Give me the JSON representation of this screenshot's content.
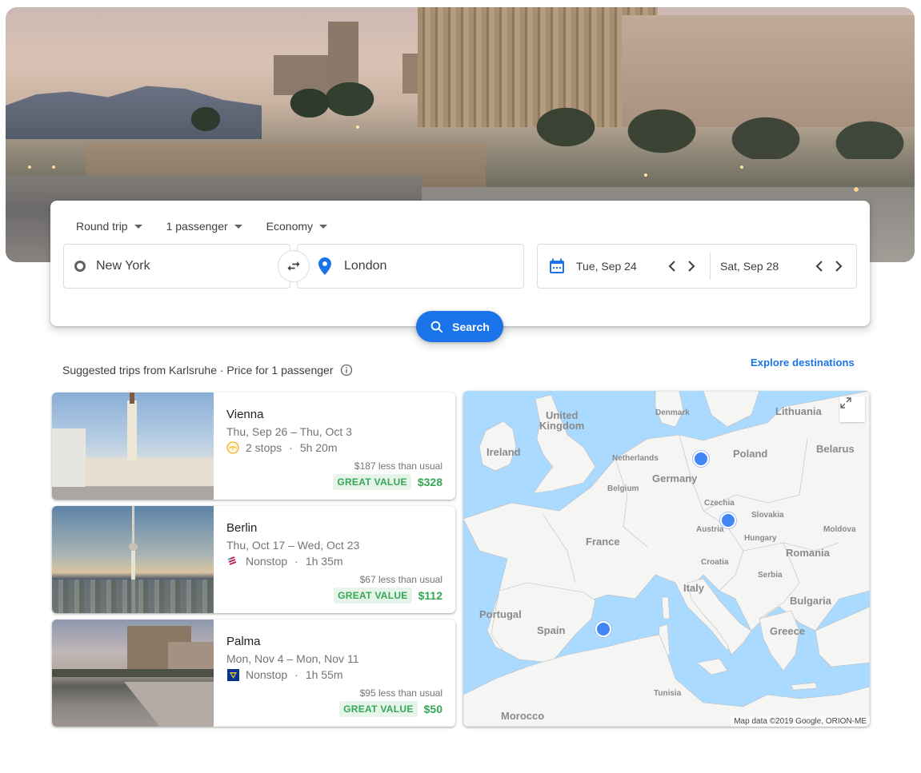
{
  "search": {
    "trip_type": "Round trip",
    "passengers": "1 passenger",
    "cabin_class": "Economy",
    "origin": "New York",
    "destination": "London",
    "depart_date": "Tue, Sep 24",
    "return_date": "Sat, Sep 28",
    "search_label": "Search"
  },
  "suggestions": {
    "title": "Suggested trips from Karlsruhe · Price for 1 passenger",
    "explore_label": "Explore destinations",
    "trips": [
      {
        "city": "Vienna",
        "dates": "Thu, Sep 26 – Thu, Oct 3",
        "stops": "2 stops",
        "duration": "5h 20m",
        "airline_icon": "lufthansa-icon",
        "savings": "$187 less than usual",
        "badge": "GREAT VALUE",
        "price": "$328"
      },
      {
        "city": "Berlin",
        "dates": "Thu, Oct 17 – Wed, Oct 23",
        "stops": "Nonstop",
        "duration": "1h 35m",
        "airline_icon": "eurowings-icon",
        "savings": "$67 less than usual",
        "badge": "GREAT VALUE",
        "price": "$112"
      },
      {
        "city": "Palma",
        "dates": "Mon, Nov 4 – Mon, Nov 11",
        "stops": "Nonstop",
        "duration": "1h 55m",
        "airline_icon": "ryanair-icon",
        "savings": "$95 less than usual",
        "badge": "GREAT VALUE",
        "price": "$50"
      }
    ]
  },
  "map": {
    "labels_large": [
      "United",
      "Kingdom",
      "Ireland",
      "Germany",
      "Poland",
      "Belarus",
      "Lithuania",
      "France",
      "Romania",
      "Italy",
      "Spain",
      "Portugal",
      "Bulgaria",
      "Greece",
      "Morocco"
    ],
    "labels_small": [
      "Denmark",
      "Netherlands",
      "Belgium",
      "Czechia",
      "Slovakia",
      "Austria",
      "Hungary",
      "Moldova",
      "Croatia",
      "Serbia",
      "Tunisia"
    ],
    "markers": [
      "Berlin",
      "Vienna",
      "Palma"
    ],
    "attribution": "Map data ©2019 Google, ORION-ME"
  },
  "colors": {
    "primary": "#1a73e8",
    "great_value": "#34a853",
    "map_water": "#aadaff",
    "map_land": "#f5f5f3"
  }
}
